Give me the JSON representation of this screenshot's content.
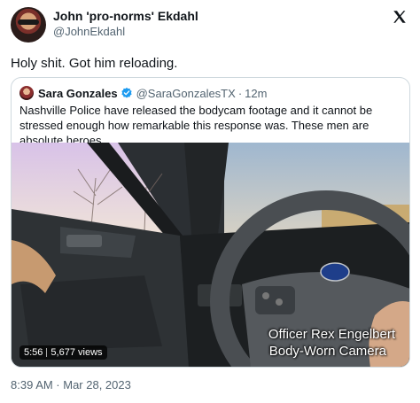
{
  "tweet": {
    "author_name": "John 'pro-norms' Ekdahl",
    "author_handle": "@JohnEkdahl",
    "text": "Holy shit. Got him reloading.",
    "timestamp": "8:39 AM · Mar 28, 2023"
  },
  "quoted_tweet": {
    "author_name": "Sara Gonzales",
    "author_handle": "@SaraGonzalesTX",
    "separator": "·",
    "time": "12m",
    "text": "Nashville Police have released the bodycam footage and it cannot be stressed enough how remarkable this response was. These men are absolute heroes.",
    "video": {
      "overlay_line1": "Officer Rex Engelbert",
      "overlay_line2": "Body-Worn Camera",
      "duration": "5:56",
      "views": "5,677 views"
    }
  },
  "icons": {
    "logo": "x-logo-icon",
    "verified": "verified-badge-icon"
  },
  "colors": {
    "verified": "#1d9bf0",
    "secondary_text": "#536471",
    "border": "#cfd9de"
  }
}
